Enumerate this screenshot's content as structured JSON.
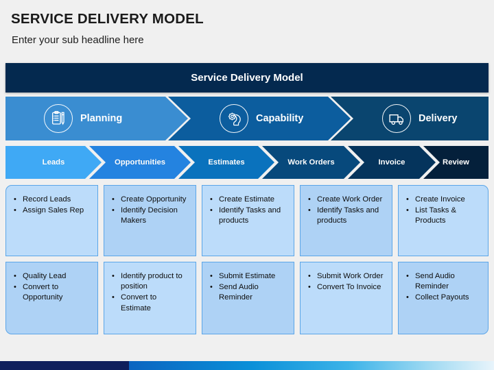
{
  "header": {
    "title": "SERVICE DELIVERY MODEL",
    "subtitle": "Enter your sub headline here"
  },
  "banner": {
    "label": "Service Delivery Model",
    "color": "#04294f"
  },
  "phases": [
    {
      "label": "Planning",
      "icon": "clipboard-pen-icon",
      "color": "#3a8dd1"
    },
    {
      "label": "Capability",
      "icon": "head-gear-icon",
      "color": "#0c5d9e"
    },
    {
      "label": "Delivery",
      "icon": "delivery-truck-icon",
      "color": "#0a456f"
    }
  ],
  "stages": [
    {
      "label": "Leads",
      "color": "#3fa9f5"
    },
    {
      "label": "Opportunities",
      "color": "#2483e0"
    },
    {
      "label": "Estimates",
      "color": "#0a72bd"
    },
    {
      "label": "Work Orders",
      "color": "#07497c"
    },
    {
      "label": "Invoice",
      "color": "#05345c"
    },
    {
      "label": "Review",
      "color": "#04203b"
    }
  ],
  "columns": [
    {
      "stage": "Leads",
      "row1": [
        "Record Leads",
        "Assign Sales Rep"
      ],
      "row2": [
        "Quality Lead",
        "Convert to Opportunity"
      ]
    },
    {
      "stage": "Opportunities",
      "row1": [
        "Create Opportunity",
        "Identify Decision Makers"
      ],
      "row2": [
        "Identify product to position",
        "Convert to Estimate"
      ]
    },
    {
      "stage": "Estimates",
      "row1": [
        "Create Estimate",
        "Identify Tasks and products"
      ],
      "row2": [
        "Submit Estimate",
        "Send Audio Reminder"
      ]
    },
    {
      "stage": "Work Orders",
      "row1": [
        "Create Work Order",
        "Identify Tasks and products"
      ],
      "row2": [
        "Submit Work Order",
        "Convert To Invoice"
      ]
    },
    {
      "stage": "Invoice / Review",
      "row1": [
        "Create Invoice",
        "List Tasks & Products"
      ],
      "row2": [
        "Send Audio Reminder",
        "Collect Payouts"
      ]
    }
  ],
  "footer": {
    "navy_color": "#0f1f5c",
    "gradient_from": "#0b64c0",
    "gradient_to": "#e8f4fb"
  }
}
